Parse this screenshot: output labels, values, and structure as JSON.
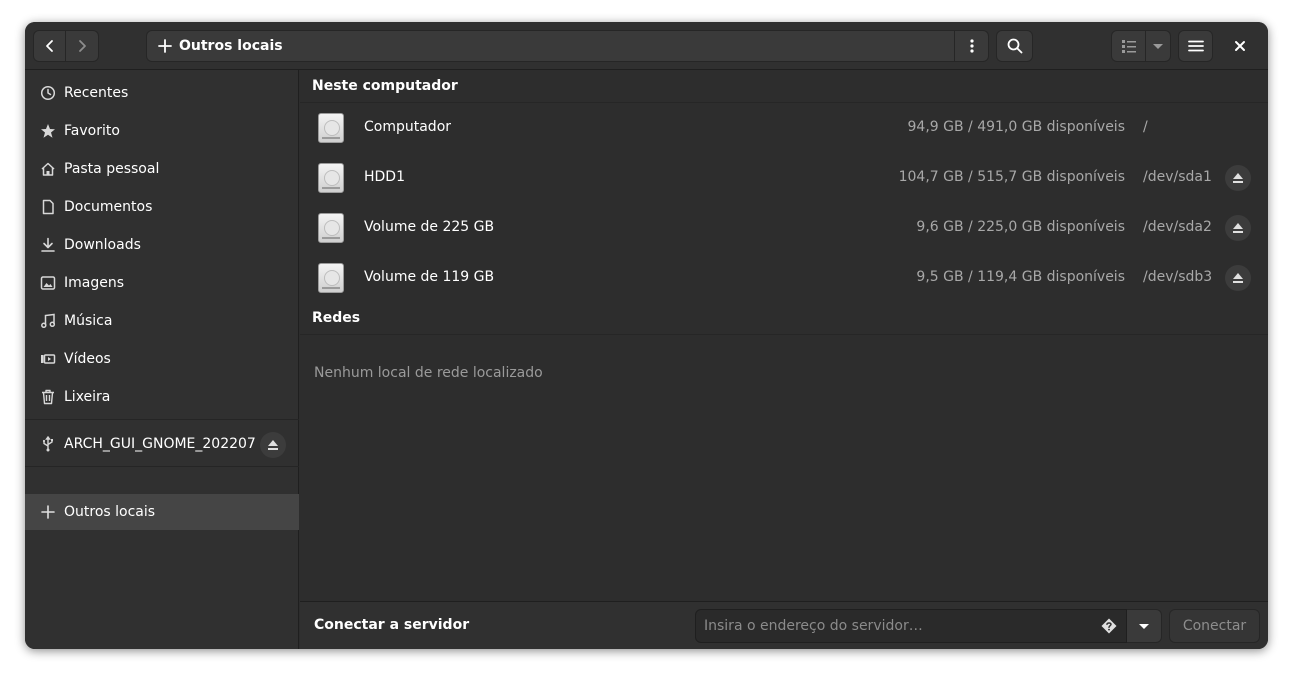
{
  "header": {
    "path_label": "Outros locais",
    "path_icon": "plus-icon"
  },
  "sidebar": {
    "items": [
      {
        "label": "Recentes",
        "icon": "clock-icon"
      },
      {
        "label": "Favorito",
        "icon": "star-icon"
      },
      {
        "label": "Pasta pessoal",
        "icon": "home-icon"
      },
      {
        "label": "Documentos",
        "icon": "document-icon"
      },
      {
        "label": "Downloads",
        "icon": "download-icon"
      },
      {
        "label": "Imagens",
        "icon": "image-icon"
      },
      {
        "label": "Música",
        "icon": "music-icon"
      },
      {
        "label": "Vídeos",
        "icon": "video-icon"
      },
      {
        "label": "Lixeira",
        "icon": "trash-icon"
      }
    ],
    "device": {
      "label": "ARCH_GUI_GNOME_202207",
      "icon": "usb-icon"
    },
    "other_locations": {
      "label": "Outros locais",
      "icon": "plus-icon",
      "active": true
    }
  },
  "main": {
    "computer_section": "Neste computador",
    "drives": [
      {
        "name": "Computador",
        "space": "94,9 GB / 491,0 GB disponíveis",
        "device": "/",
        "ejectable": false
      },
      {
        "name": "HDD1",
        "space": "104,7 GB / 515,7 GB disponíveis",
        "device": "/dev/sda1",
        "ejectable": true
      },
      {
        "name": "Volume de 225 GB",
        "space": "9,6 GB / 225,0 GB disponíveis",
        "device": "/dev/sda2",
        "ejectable": true
      },
      {
        "name": "Volume de 119 GB",
        "space": "9,5 GB / 119,4 GB disponíveis",
        "device": "/dev/sdb3",
        "ejectable": true
      }
    ],
    "network_section": "Redes",
    "no_network": "Nenhum local de rede localizado"
  },
  "bottom": {
    "connect_label": "Conectar a servidor",
    "server_placeholder": "Insira o endereço do servidor…",
    "server_value": "",
    "connect_button": "Conectar"
  },
  "colors": {
    "window_bg": "#2d2d2d",
    "sidebar_bg": "#303030",
    "active_item": "#454545",
    "muted_text": "#a8a8a8"
  }
}
